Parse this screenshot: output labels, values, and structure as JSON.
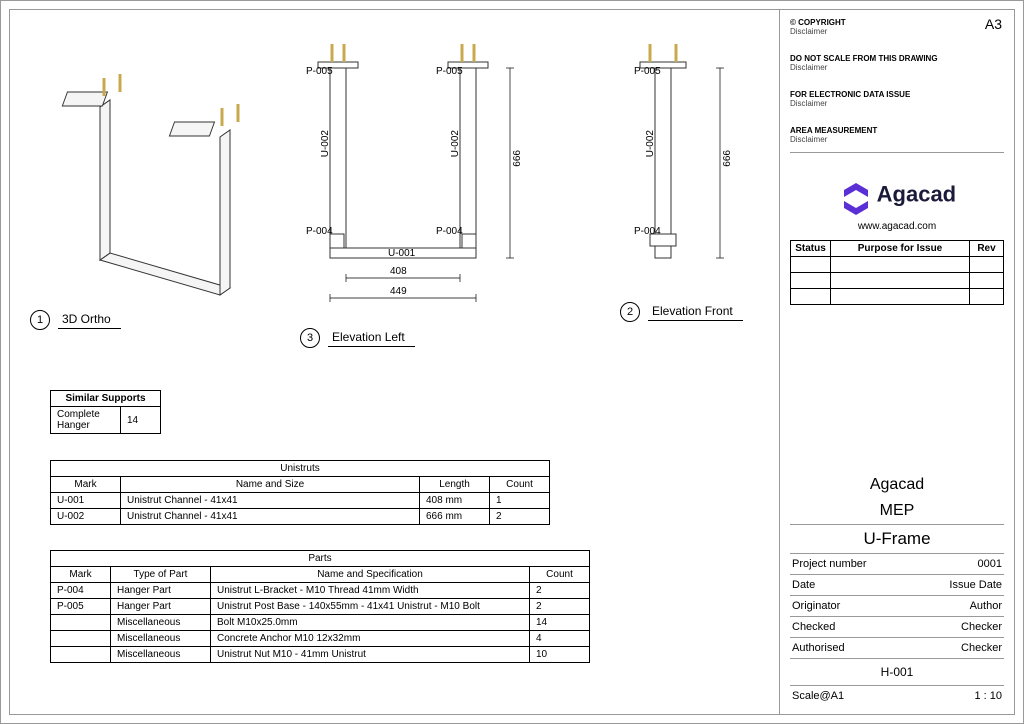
{
  "sheet_size": "A3",
  "copyright": {
    "title": "© COPYRIGHT",
    "text": "Disclaimer"
  },
  "disclaimers": [
    {
      "title": "DO NOT SCALE FROM THIS DRAWING",
      "text": "Disclaimer"
    },
    {
      "title": "FOR ELECTRONIC DATA ISSUE",
      "text": "Disclaimer"
    },
    {
      "title": "AREA MEASUREMENT",
      "text": "Disclaimer"
    }
  ],
  "logo": {
    "name": "Agacad",
    "url": "www.agacad.com"
  },
  "issue_table": {
    "headers": [
      "Status",
      "Purpose for Issue",
      "Rev"
    ]
  },
  "title_block": {
    "client": "Agacad",
    "discipline": "MEP",
    "drawing_title": "U-Frame",
    "rows": [
      {
        "label": "Project number",
        "value": "0001"
      },
      {
        "label": "Date",
        "value": "Issue Date"
      },
      {
        "label": "Originator",
        "value": "Author"
      },
      {
        "label": "Checked",
        "value": "Checker"
      },
      {
        "label": "Authorised",
        "value": "Checker"
      }
    ],
    "sheet_number": "H-001",
    "scale_label": "Scale@A1",
    "scale_value": "1 : 10"
  },
  "views": {
    "v1": {
      "num": "1",
      "title": "3D Ortho"
    },
    "v2": {
      "num": "2",
      "title": "Elevation Front"
    },
    "v3": {
      "num": "3",
      "title": "Elevation Left"
    }
  },
  "similar_supports": {
    "title": "Similar Supports",
    "label": "Complete Hanger",
    "count": "14"
  },
  "unistruts": {
    "title": "Unistruts",
    "headers": [
      "Mark",
      "Name and Size",
      "Length",
      "Count"
    ],
    "rows": [
      {
        "mark": "U-001",
        "name": "Unistrut Channel - 41x41",
        "length": "408 mm",
        "count": "1"
      },
      {
        "mark": "U-002",
        "name": "Unistrut Channel - 41x41",
        "length": "666 mm",
        "count": "2"
      }
    ]
  },
  "parts": {
    "title": "Parts",
    "headers": [
      "Mark",
      "Type of Part",
      "Name and Specification",
      "Count"
    ],
    "rows": [
      {
        "mark": "P-004",
        "type": "Hanger Part",
        "name": "Unistrut L-Bracket - M10 Thread 41mm Width",
        "count": "2"
      },
      {
        "mark": "P-005",
        "type": "Hanger Part",
        "name": "Unistrut Post Base - 140x55mm - 41x41 Unistrut - M10 Bolt",
        "count": "2"
      },
      {
        "mark": "",
        "type": "Miscellaneous",
        "name": "Bolt M10x25.0mm",
        "count": "14"
      },
      {
        "mark": "",
        "type": "Miscellaneous",
        "name": "Concrete Anchor M10 12x32mm",
        "count": "4"
      },
      {
        "mark": "",
        "type": "Miscellaneous",
        "name": "Unistrut Nut M10 - 41mm Unistrut",
        "count": "10"
      }
    ]
  },
  "dims": {
    "w_inner": "408",
    "w_outer": "449",
    "h_left": "666",
    "h_front": "666"
  },
  "labels": {
    "p004": "P-004",
    "p005": "P-005",
    "u001": "U-001",
    "u002": "U-002"
  }
}
